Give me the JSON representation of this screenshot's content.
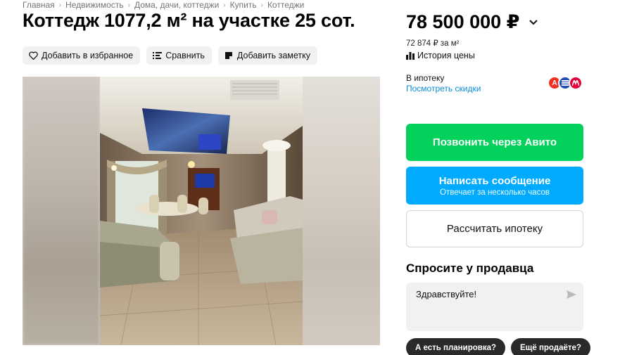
{
  "breadcrumb": [
    "Главная",
    "Недвижимость",
    "Дома, дачи, коттеджи",
    "Купить",
    "Коттеджи"
  ],
  "title": "Коттедж 1077,2 м² на участке 25 сот.",
  "actions": {
    "favorite": "Добавить в избранное",
    "compare": "Сравнить",
    "note": "Добавить заметку"
  },
  "price": {
    "value": "78 500 000 ₽",
    "per_m2": "72 874 ₽ за м²",
    "history": "История цены"
  },
  "mortgage": {
    "label": "В ипотеку",
    "link": "Посмотреть скидки",
    "banks": [
      {
        "name": "alfa-bank",
        "letter": "А",
        "color": "#ef3124"
      },
      {
        "name": "bank-blue",
        "letter": "",
        "color": "#1f4db8"
      },
      {
        "name": "bank-red",
        "letter": "",
        "color": "#e4003a"
      }
    ]
  },
  "buttons": {
    "call": "Позвонить через Авито",
    "message": "Написать сообщение",
    "message_sub": "Отвечает за несколько часов",
    "calc_mortgage": "Рассчитать ипотеку"
  },
  "ask": {
    "title": "Спросите у продавца",
    "message": "Здравствуйте!",
    "chips": [
      "А есть планировка?",
      "Ещё продаёте?"
    ]
  },
  "colors": {
    "call": "#02d15c",
    "message": "#00aaff",
    "link": "#0a8bd9"
  }
}
